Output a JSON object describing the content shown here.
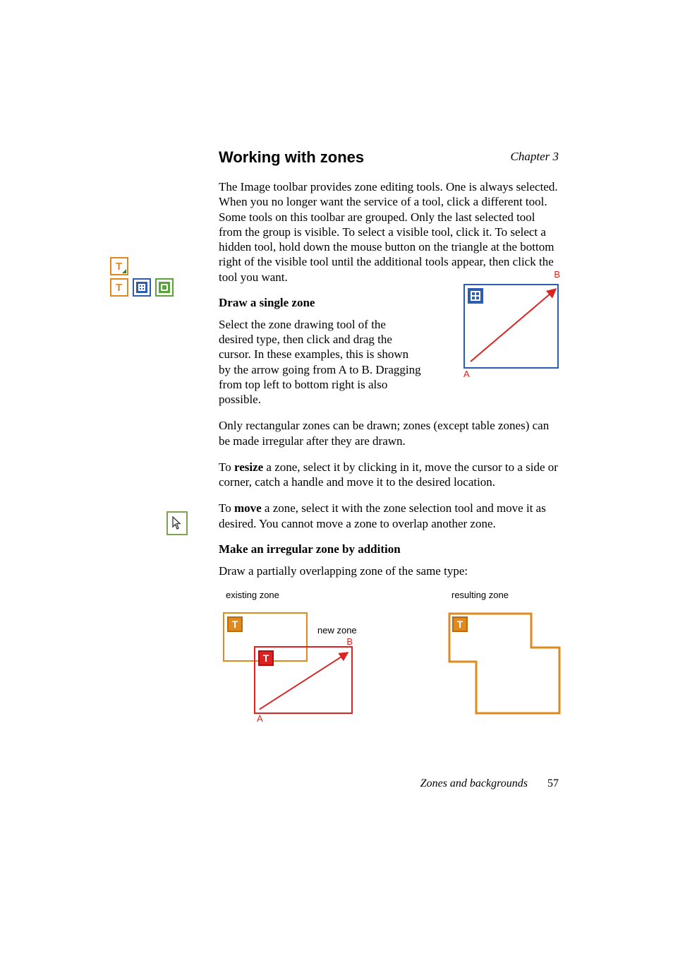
{
  "chapter": "Chapter 3",
  "title": "Working with zones",
  "p1": "The Image toolbar provides zone editing tools. One is always selected. When you no longer want the service of a tool, click a different tool. Some tools on this toolbar are grouped. Only the last selected tool from the group is visible. To select a visible tool, click it. To select a hidden tool, hold down the mouse button on the triangle at the bottom right of the visible tool until the additional tools appear, then click the tool you want.",
  "draw_head": "Draw a single zone",
  "draw_p": "Select the zone drawing tool of the desired type, then click and drag the cursor. In these examples, this is shown by the arrow going from A to B. Dragging from top left to bottom right is also possible.",
  "only_rect": "Only rectangular zones can be drawn; zones (except table zones) can be made irregular after they are drawn.",
  "resize_pre": "To ",
  "resize_bold": "resize",
  "resize_post": " a zone, select it by clicking in it, move the cursor to a side or corner, catch a handle and move it to the desired location.",
  "move_pre": "To ",
  "move_bold": "move",
  "move_post": " a zone, select it with the zone selection tool and move it as desired. You cannot move a zone to overlap another zone.",
  "irr_head": "Make an irregular zone by addition",
  "irr_p": "Draw a partially overlapping zone of the same type:",
  "labels": {
    "existing": "existing zone",
    "new": "new zone",
    "resulting": "resulting zone",
    "A": "A",
    "B": "B",
    "T": "T"
  },
  "footer": {
    "section": "Zones and backgrounds",
    "page": "57"
  },
  "colors": {
    "orange": "#e08a1d",
    "blue": "#2d5db3",
    "green": "#5aa33b",
    "red": "#d22"
  }
}
